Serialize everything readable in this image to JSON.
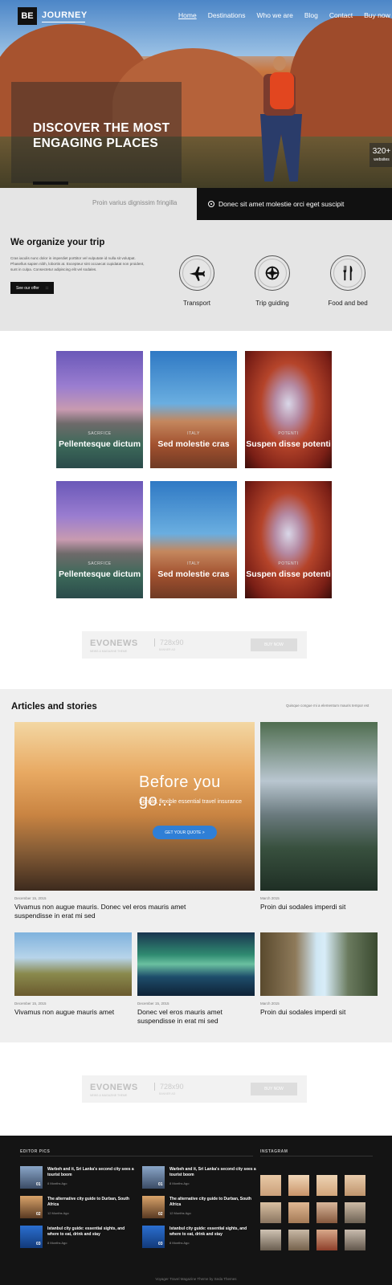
{
  "header": {
    "logo_box": "BE",
    "logo_word": "JOURNEY",
    "nav": [
      "Home",
      "Destinations",
      "Who we are",
      "Blog",
      "Contact",
      "Buy now"
    ]
  },
  "hero": {
    "title": "DISCOVER THE MOST ENGAGING PLACES",
    "stat_number": "320+",
    "stat_label": "websites"
  },
  "ticker": {
    "left": "Proin varius dignissim fringilla",
    "right": "Donec sit amet molestie orci eget suscipit"
  },
  "organize": {
    "title": "We organize your trip",
    "body": "Cras iaculis nunc dolor in imperdiet porttitor vel vulputate id nulla sit volutpat. Phasellus sapien nibh, lobortis at. Excepteur sint occaecat cupidatat non proident, sunt in culpa. Consectetur adipiscing elit vel sodales.",
    "button": "See our offer",
    "services": [
      "Transport",
      "Trip guiding",
      "Food and bed"
    ]
  },
  "gallery": [
    {
      "category": "SACRFICE",
      "title": "Pellentesque dictum"
    },
    {
      "category": "ITALY",
      "title": "Sed molestie cras"
    },
    {
      "category": "POTENTI",
      "title": "Suspen disse potenti"
    },
    {
      "category": "SACRFICE",
      "title": "Pellentesque dictum"
    },
    {
      "category": "ITALY",
      "title": "Sed molestie cras"
    },
    {
      "category": "POTENTI",
      "title": "Suspen disse potenti"
    }
  ],
  "ad": {
    "brand": "EVONEWS",
    "tagline": "NEWS & MAGAZINE THEME",
    "size": "728x90",
    "size_sub": "BANNER AD",
    "button": "BUY NOW"
  },
  "articles": {
    "title": "Articles and stories",
    "hint": "Quisque congue mi a elementum mauris tempor est",
    "promo_title": "Before you go...",
    "promo_sub": "Simple, flexible essential travel insurance",
    "promo_button": "GET YOUR QUOTE >",
    "items": [
      {
        "meta": "December 15, 2015",
        "title": "Vivamus non augue mauris. Donec vel eros mauris amet suspendisse in erat mi sed"
      },
      {
        "meta": "March 2015",
        "title": "Proin dui sodales imperdi sit"
      },
      {
        "meta": "December 15, 2015",
        "title": "Vivamus non augue mauris amet"
      },
      {
        "meta": "December 15, 2015",
        "title": "Donec vel eros mauris amet suspendisse in erat mi sed"
      },
      {
        "meta": "March 2015",
        "title": "Proin dui sodales imperdi sit"
      }
    ]
  },
  "footer": {
    "editor_heading": "EDITOR PICS",
    "instagram_heading": "INSTAGRAM",
    "picks": [
      {
        "num": "01",
        "title": "Warbeh and it, Sri Lanka's second city sees a tourist boom",
        "date": "8 Months Ago"
      },
      {
        "num": "02",
        "title": "The alternative city guide to Durban, South Africa",
        "date": "12 Months Ago"
      },
      {
        "num": "03",
        "title": "Istanbul city guide: essential sights, and where to eat, drink and stay",
        "date": "8 Months Ago"
      },
      {
        "num": "01",
        "title": "Warbeh and it, Sri Lanka's second city sees a tourist boom",
        "date": "8 Months Ago"
      },
      {
        "num": "02",
        "title": "The alternative city guide to Durban, South Africa",
        "date": "12 Months Ago"
      },
      {
        "num": "03",
        "title": "Istanbul city guide: essential sights, and where to eat, drink and stay",
        "date": "8 Months Ago"
      }
    ],
    "copyright": "Voyager Travel Magazine Theme by Seda Themes"
  }
}
